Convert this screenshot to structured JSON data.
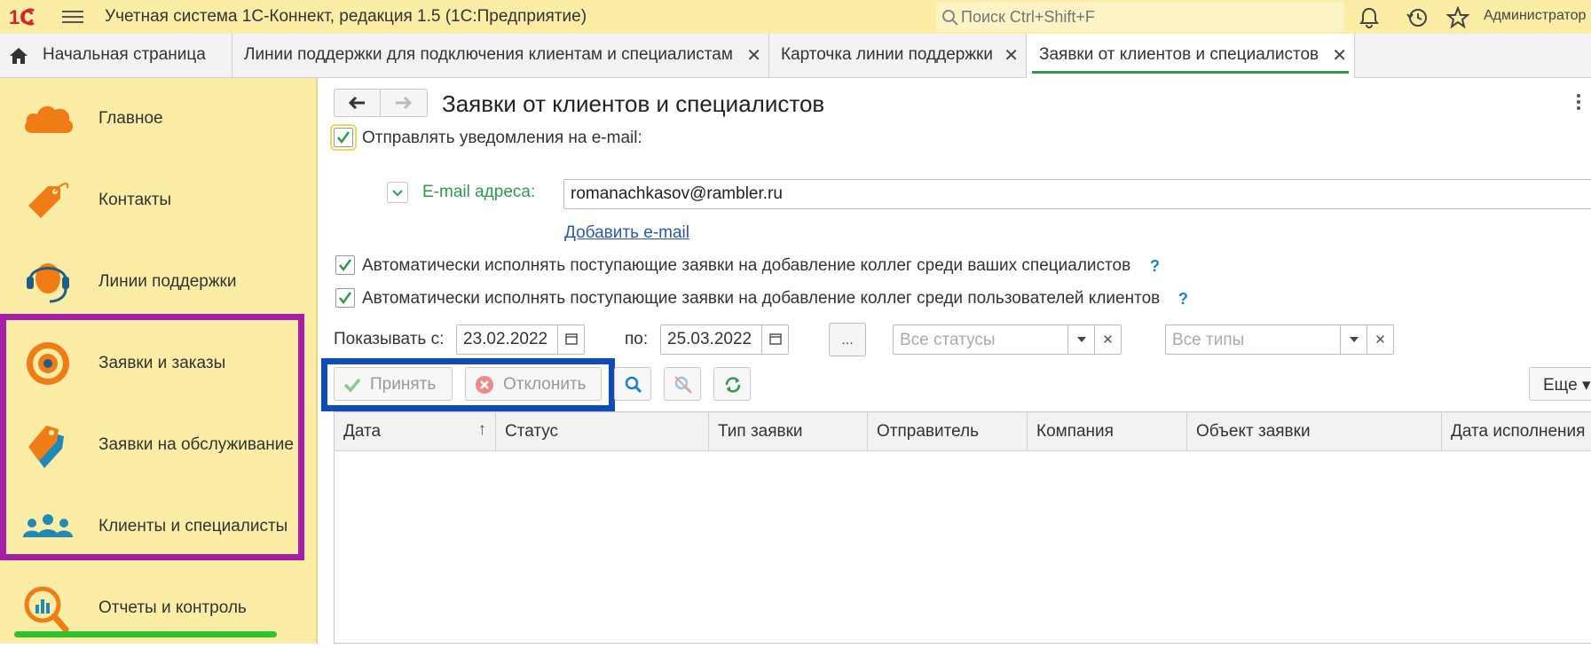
{
  "topbar": {
    "logo": "1С",
    "app_title": "Учетная система 1С-Коннект, редакция 1.5  (1С:Предприятие)",
    "search_placeholder": "Поиск Ctrl+Shift+F",
    "icons": [
      "bell-icon",
      "history-icon",
      "star-icon"
    ],
    "username": "Администратор"
  },
  "tabs": [
    {
      "label": "Начальная страница",
      "icon": "home-icon",
      "closable": false,
      "active": false
    },
    {
      "label": "Линии поддержки для подключения клиентам и специалистам",
      "closable": true,
      "active": false
    },
    {
      "label": "Карточка линии поддержки",
      "closable": true,
      "active": false
    },
    {
      "label": "Заявки от клиентов и специалистов",
      "closable": true,
      "active": true
    }
  ],
  "tab_close_glyph": "✕",
  "sidebar": {
    "items": [
      {
        "label": "Главное",
        "icon": "cloud-icon"
      },
      {
        "label": "Контакты",
        "icon": "tag-icon"
      },
      {
        "label": "Линии поддержки",
        "icon": "headset-icon"
      },
      {
        "label": "Заявки и заказы",
        "icon": "target-icon"
      },
      {
        "label": "Заявки на обслуживание",
        "icon": "tags-icon"
      },
      {
        "label": "Клиенты и специалисты",
        "icon": "people-icon"
      },
      {
        "label": "Отчеты и контроль",
        "icon": "chart-magnifier-icon"
      }
    ],
    "highlight_color": "#a51ea6",
    "underline_color": "#2ec42e"
  },
  "main": {
    "title": "Заявки от клиентов и специалистов",
    "notify_email": {
      "label": "Отправлять уведомления на e-mail:",
      "checked": true
    },
    "email_label": "E-mail адреса:",
    "email_value": "romanachkasov@rambler.ru",
    "add_email_link": "Добавить e-mail",
    "auto_colleagues_specialists": {
      "label": "Автоматически исполнять поступающие заявки на добавление коллег среди ваших специалистов",
      "checked": true
    },
    "auto_colleagues_clients": {
      "label": "Автоматически исполнять поступающие заявки на добавление коллег среди пользователей клиентов",
      "checked": true
    },
    "help_glyph": "?",
    "filter": {
      "show_from_label": "Показывать с:",
      "date_from": "23.02.2022",
      "to_label": "по:",
      "date_to": "25.03.2022",
      "period_button": "...",
      "status_placeholder": "Все статусы",
      "type_placeholder": "Все типы",
      "clear_glyph": "✕"
    },
    "actions": {
      "accept": "Принять",
      "decline": "Отклонить",
      "more": "Еще",
      "highlight_color": "#0f4cb8"
    },
    "table": {
      "columns": [
        "Дата",
        "Статус",
        "Тип заявки",
        "Отправитель",
        "Компания",
        "Объект заявки",
        "Дата исполнения"
      ],
      "sort_glyph": "↑",
      "rows": []
    }
  },
  "colors": {
    "accent_yellow": "#fbeca6",
    "green": "#2e9a4a",
    "link": "#2a58ad",
    "icon_orange": "#f07c16"
  }
}
